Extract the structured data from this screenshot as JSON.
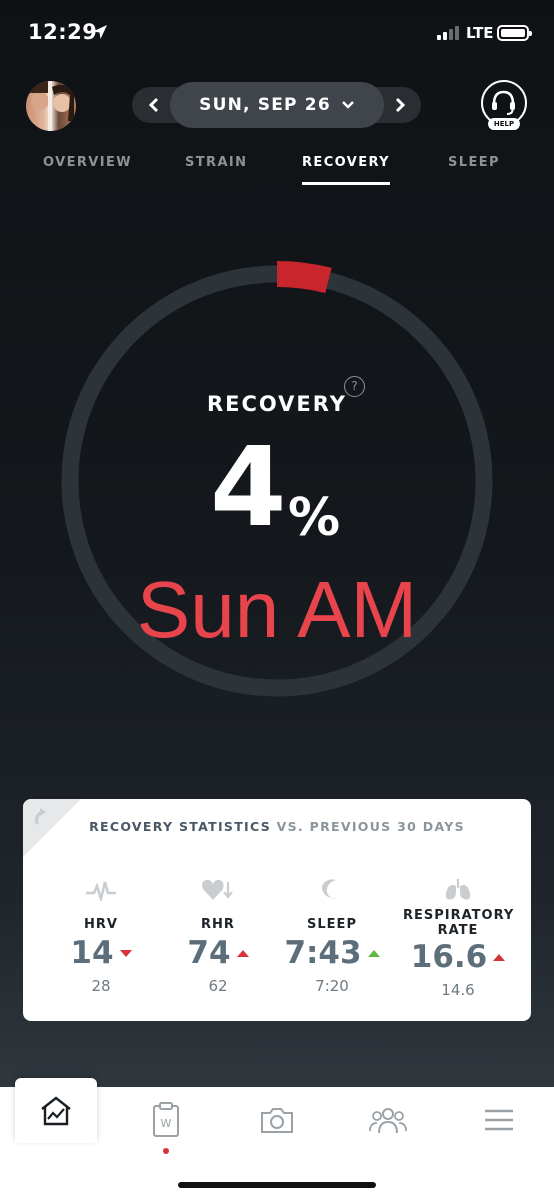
{
  "status_bar": {
    "time": "12:29",
    "network": "LTE"
  },
  "header": {
    "date": "SUN, SEP 26",
    "help_label": "HELP"
  },
  "tabs": [
    {
      "label": "OVERVIEW",
      "active": false
    },
    {
      "label": "STRAIN",
      "active": false
    },
    {
      "label": "RECOVERY",
      "active": true
    },
    {
      "label": "SLEEP",
      "active": false
    }
  ],
  "recovery": {
    "title": "RECOVERY",
    "value": "4",
    "unit": "%",
    "percent_fraction": 0.04,
    "ring_color": "#c8262c",
    "ring_track_color": "#2c3339",
    "overlay_text": "Sun AM"
  },
  "stats_card": {
    "title_main": "RECOVERY STATISTICS",
    "title_sub": "VS. PREVIOUS 30 DAYS",
    "stats": [
      {
        "label": "HRV",
        "value": "14",
        "previous": "28",
        "trend": "down",
        "icon": "hrv-icon"
      },
      {
        "label": "RHR",
        "value": "74",
        "previous": "62",
        "trend": "up",
        "icon": "heart-icon"
      },
      {
        "label": "SLEEP",
        "value": "7:43",
        "previous": "7:20",
        "trend": "up-good",
        "icon": "moon-icon"
      },
      {
        "label": "RESPIRATORY RATE",
        "value": "16.6",
        "previous": "14.6",
        "trend": "up",
        "icon": "lungs-icon"
      }
    ]
  },
  "bottom_nav": [
    "home-icon",
    "journal-icon",
    "camera-icon",
    "team-icon",
    "menu-icon"
  ],
  "colors": {
    "accent_red": "#d6333c",
    "trend_green": "#5fb840",
    "overlay_red": "#e8444b"
  }
}
